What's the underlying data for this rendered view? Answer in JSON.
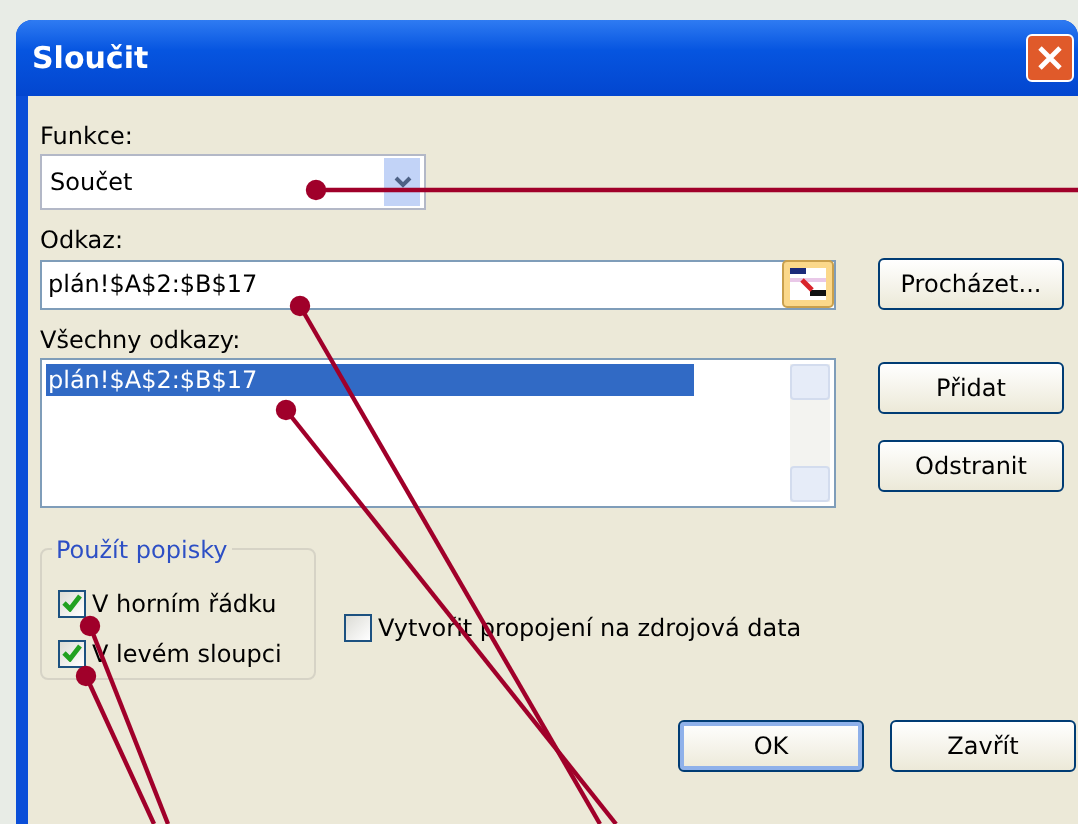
{
  "window": {
    "title": "Sloučit"
  },
  "function_field": {
    "label": "Funkce:",
    "value": "Součet"
  },
  "reference_field": {
    "label": "Odkaz:",
    "value": "plán!$A$2:$B$17"
  },
  "browse_button": {
    "label": "Procházet..."
  },
  "all_references": {
    "label": "Všechny odkazy:",
    "items": [
      {
        "text": "plán!$A$2:$B$17",
        "selected": true
      }
    ]
  },
  "side_buttons": [
    {
      "label": "Přidat"
    },
    {
      "label": "Odstranit"
    }
  ],
  "use_labels": {
    "title": "Použít popisky",
    "options": [
      {
        "label": "V horním řádku",
        "checked": true
      },
      {
        "label": "V levém sloupci",
        "checked": true
      }
    ]
  },
  "link_option": {
    "label": "Vytvořit propojení na zdrojová data",
    "checked": false
  },
  "buttons": [
    {
      "label": "OK",
      "default": true
    },
    {
      "label": "Zavřít",
      "default": false
    }
  ]
}
